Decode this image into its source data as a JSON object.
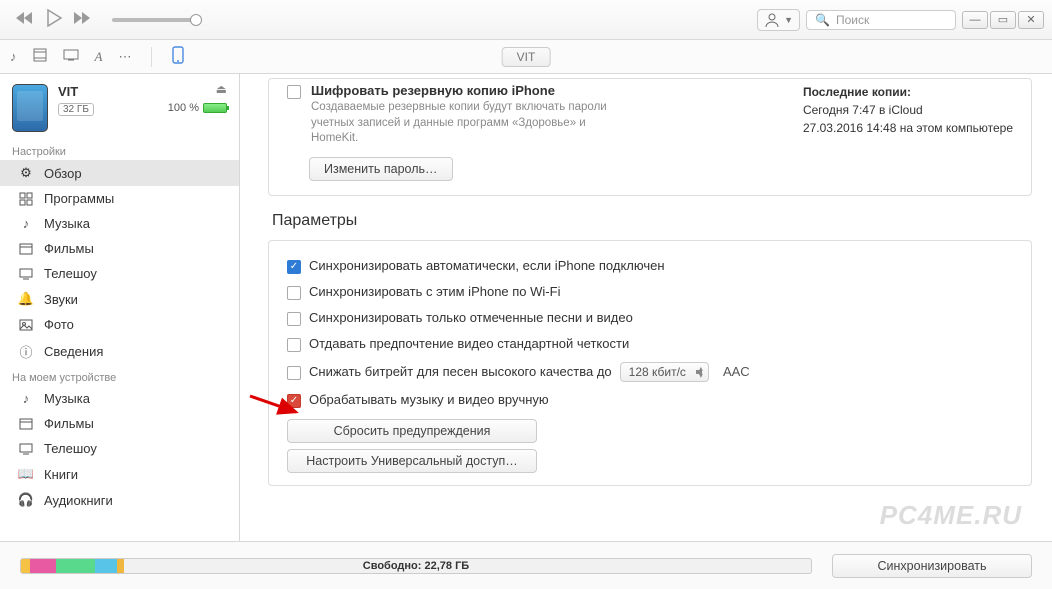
{
  "search": {
    "placeholder": "Поиск"
  },
  "device_tab": "VIT",
  "device": {
    "name": "VIT",
    "capacity": "32 ГБ",
    "battery": "100 %"
  },
  "sidebar": {
    "settings_heading": "Настройки",
    "settings": [
      {
        "label": "Обзор",
        "icon": "gear"
      },
      {
        "label": "Программы",
        "icon": "apps"
      },
      {
        "label": "Музыка",
        "icon": "music"
      },
      {
        "label": "Фильмы",
        "icon": "film"
      },
      {
        "label": "Телешоу",
        "icon": "tv"
      },
      {
        "label": "Звуки",
        "icon": "bell"
      },
      {
        "label": "Фото",
        "icon": "photo"
      },
      {
        "label": "Сведения",
        "icon": "info"
      }
    ],
    "ondevice_heading": "На моем устройстве",
    "ondevice": [
      {
        "label": "Музыка",
        "icon": "music"
      },
      {
        "label": "Фильмы",
        "icon": "film"
      },
      {
        "label": "Телешоу",
        "icon": "tv"
      },
      {
        "label": "Книги",
        "icon": "book"
      },
      {
        "label": "Аудиокниги",
        "icon": "audiobook"
      }
    ]
  },
  "backup": {
    "encrypt_title": "Шифровать резервную копию iPhone",
    "encrypt_sub": "Создаваемые резервные копии будут включать пароли учетных записей и данные программ «Здоровье» и HomeKit.",
    "change_pw": "Изменить пароль…",
    "last_heading": "Последние копии:",
    "last_line1": "Сегодня 7:47 в iCloud",
    "last_line2": "27.03.2016 14:48 на этом компьютере"
  },
  "params": {
    "heading": "Параметры",
    "auto_sync": "Синхронизировать автоматически, если iPhone подключен",
    "wifi_sync": "Синхронизировать с этим iPhone по Wi-Fi",
    "only_checked": "Синхронизировать только отмеченные песни и видео",
    "prefer_sd": "Отдавать предпочтение видео стандартной четкости",
    "lower_bitrate": "Снижать битрейт для песен высокого качества до",
    "bitrate_value": "128 кбит/с",
    "bitrate_suffix": "AAC",
    "manual": "Обрабатывать музыку и видео вручную",
    "reset_warnings": "Сбросить предупреждения",
    "configure_access": "Настроить Универсальный доступ…"
  },
  "footer": {
    "free": "Свободно: 22,78 ГБ",
    "sync": "Синхронизировать"
  },
  "storage_segments": [
    {
      "color": "#f6c243",
      "start": 0,
      "width": 1.2
    },
    {
      "color": "#e85aa1",
      "start": 1.2,
      "width": 3.2
    },
    {
      "color": "#59d98c",
      "start": 4.4,
      "width": 5.0
    },
    {
      "color": "#58c5e8",
      "start": 9.4,
      "width": 2.8
    },
    {
      "color": "#f0b740",
      "start": 12.2,
      "width": 0.9
    }
  ],
  "watermark": "PC4ME.RU"
}
